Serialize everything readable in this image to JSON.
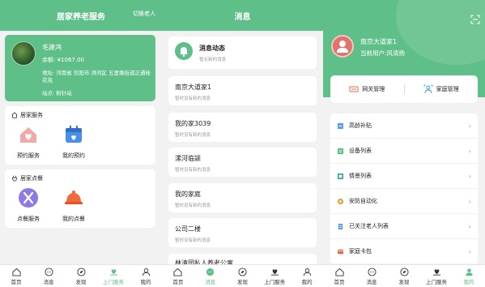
{
  "screen1": {
    "title": "居家养老服务",
    "switch_label": "切换老人",
    "profile": {
      "name": "毛建鸿",
      "balance": "余额:  ¥1067.00",
      "address": "地址:  河南省 信阳市 浉河区 五里墩街道正通桂花苑",
      "station": "站点:  粉针站"
    },
    "home_service": {
      "heading": "居家服务",
      "items": [
        {
          "label": "预约服务"
        },
        {
          "label": "我的预约"
        }
      ]
    },
    "meal": {
      "heading": "居家点餐",
      "items": [
        {
          "label": "点餐服务"
        },
        {
          "label": "我的点餐"
        }
      ]
    }
  },
  "screen2": {
    "title": "消息",
    "header_card": {
      "title": "消息动态",
      "sub": "暂无新的消息"
    },
    "messages": [
      {
        "title": "南京大道家1",
        "sub": "暂时没有新的消息"
      },
      {
        "title": "我的家3039",
        "sub": "暂时没有新的消息"
      },
      {
        "title": "漯河临颍",
        "sub": "暂时没有新的消息"
      },
      {
        "title": "我的家庭",
        "sub": "暂时没有新的消息"
      },
      {
        "title": "公司二楼",
        "sub": "暂时没有新的消息"
      },
      {
        "title": "林清园私人养老公寓",
        "sub": ""
      }
    ]
  },
  "screen3": {
    "home_name": "南京大道家1",
    "current_user": "当前用户:风清扬",
    "gateway_label": "网关管理",
    "family_label": "家庭管理",
    "menu": [
      {
        "label": "高龄补贴",
        "icon": "subsidy-icon"
      },
      {
        "label": "设备列表",
        "icon": "device-list-icon"
      },
      {
        "label": "情景列表",
        "icon": "scene-list-icon"
      },
      {
        "label": "安防自动化",
        "icon": "security-icon"
      },
      {
        "label": "已关注老人列表",
        "icon": "followed-list-icon"
      },
      {
        "label": "家庭卡包",
        "icon": "card-wallet-icon"
      }
    ]
  },
  "tabs": {
    "home": "首页",
    "message": "消息",
    "discover": "发现",
    "service": "上门服务",
    "mine": "我的"
  },
  "colors": {
    "accent": "#5fbf88",
    "accent_light": "#e8f6ee"
  }
}
